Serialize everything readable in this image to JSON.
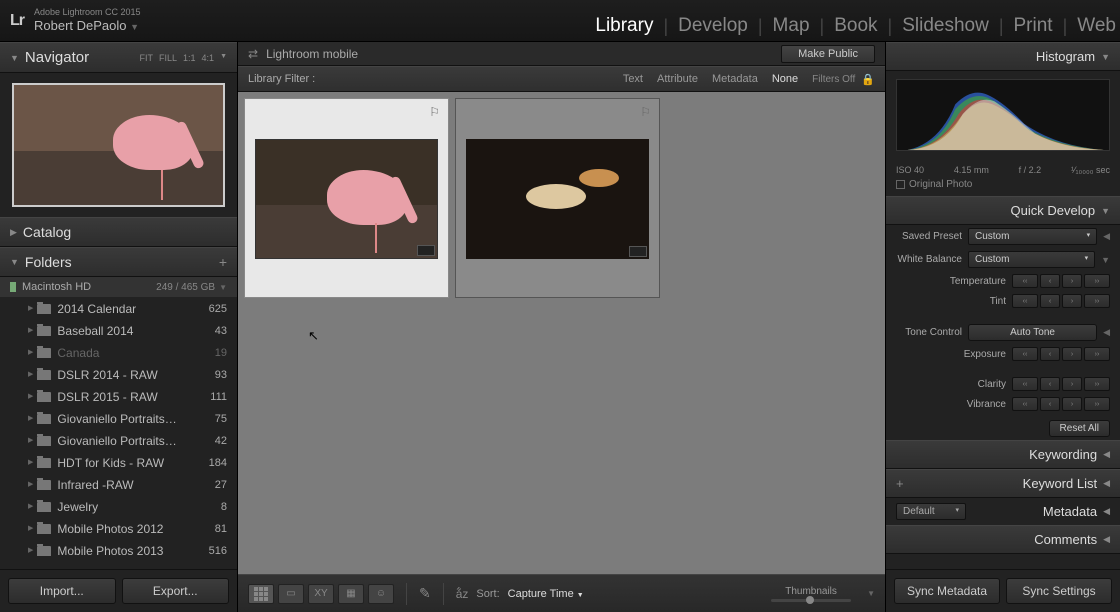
{
  "app": {
    "name": "Adobe Lightroom CC 2015",
    "user": "Robert DePaolo"
  },
  "modules": [
    "Library",
    "Develop",
    "Map",
    "Book",
    "Slideshow",
    "Print",
    "Web"
  ],
  "active_module": "Library",
  "navigator": {
    "title": "Navigator",
    "opts": [
      "FIT",
      "FILL",
      "1:1",
      "4:1"
    ]
  },
  "catalog": {
    "title": "Catalog"
  },
  "folders": {
    "title": "Folders",
    "drive": {
      "name": "Macintosh HD",
      "space": "249 / 465 GB"
    },
    "items": [
      {
        "name": "2014 Calendar",
        "count": 625,
        "dim": false
      },
      {
        "name": "Baseball 2014",
        "count": 43,
        "dim": false
      },
      {
        "name": "Canada",
        "count": 19,
        "dim": true
      },
      {
        "name": "DSLR 2014 - RAW",
        "count": 93,
        "dim": false
      },
      {
        "name": "DSLR 2015 - RAW",
        "count": 111,
        "dim": false
      },
      {
        "name": "Giovaniello Portraits…",
        "count": 75,
        "dim": false
      },
      {
        "name": "Giovaniello Portraits…",
        "count": 42,
        "dim": false
      },
      {
        "name": "HDT for Kids - RAW",
        "count": 184,
        "dim": false
      },
      {
        "name": "Infrared -RAW",
        "count": 27,
        "dim": false
      },
      {
        "name": "Jewelry",
        "count": 8,
        "dim": false
      },
      {
        "name": "Mobile Photos 2012",
        "count": 81,
        "dim": false
      },
      {
        "name": "Mobile Photos 2013",
        "count": 516,
        "dim": false
      }
    ]
  },
  "import_btn": "Import...",
  "export_btn": "Export...",
  "sync": {
    "label": "Lightroom mobile",
    "make_public": "Make Public"
  },
  "filter": {
    "label": "Library Filter :",
    "opts": [
      "Text",
      "Attribute",
      "Metadata",
      "None"
    ],
    "active": "None",
    "off": "Filters Off"
  },
  "toolbar": {
    "sort_label": "Sort:",
    "sort_value": "Capture Time",
    "thumbnails": "Thumbnails"
  },
  "histogram": {
    "title": "Histogram",
    "iso": "ISO 40",
    "focal": "4.15 mm",
    "aperture": "f / 2.2",
    "shutter": "¹⁄₁₀₀₀₀ sec",
    "original": "Original Photo"
  },
  "quick_develop": {
    "title": "Quick Develop",
    "saved_preset": {
      "label": "Saved Preset",
      "value": "Custom"
    },
    "white_balance": {
      "label": "White Balance",
      "value": "Custom"
    },
    "temperature": "Temperature",
    "tint": "Tint",
    "tone_control": {
      "label": "Tone Control",
      "button": "Auto Tone"
    },
    "exposure": "Exposure",
    "clarity": "Clarity",
    "vibrance": "Vibrance",
    "reset": "Reset All"
  },
  "panels_r": {
    "keywording": "Keywording",
    "keyword_list": "Keyword List",
    "metadata": "Metadata",
    "metadata_preset": "Default",
    "comments": "Comments"
  },
  "sync_meta": "Sync Metadata",
  "sync_settings": "Sync Settings"
}
